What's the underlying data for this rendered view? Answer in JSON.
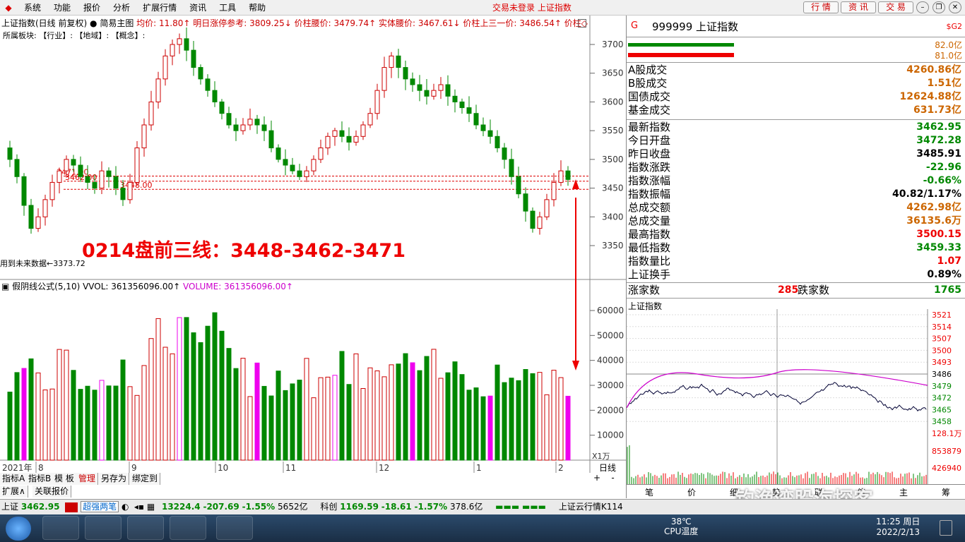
{
  "menu": {
    "items": [
      "系统",
      "功能",
      "报价",
      "分析",
      "扩展行情",
      "资讯",
      "工具",
      "帮助"
    ],
    "notice": "交易未登录  上证指数",
    "buttons": [
      "行 情",
      "资 讯",
      "交 易"
    ]
  },
  "info": {
    "line1": "上证指数(日线 前复权)",
    "main_chart": "简易主图",
    "junjia": "均价: 11.80↑",
    "zhangting": "明日涨停参考: 3809.25↓",
    "yaojia": "价柱腰价: 3479.74↑",
    "shiti": "实体腰价: 3467.61↓",
    "shangsan": "价柱上三一价: 3486.54↑",
    "jiazhu": "价柱◇",
    "line2": "所属板块:    【行业】:        【地域】:     【概念】:"
  },
  "kline": {
    "y_labels": [
      "3700",
      "3650",
      "3600",
      "3550",
      "3500",
      "3450",
      "3400",
      "3350"
    ],
    "hlines": [
      {
        "label": "3471.00",
        "value": 3471
      },
      {
        "label": "3462.00",
        "value": 3462
      },
      {
        "label": "3448.00",
        "value": 3448
      }
    ],
    "low_label": "用到未来数据",
    "low_value": "3373.72",
    "annotation": "0214盘前三线：3448-3462-3471"
  },
  "volume": {
    "title": "假阴线公式(5,10)",
    "vvol": "VVOL: 361356096.00↑",
    "volume": "VOLUME: 361356096.00↑",
    "y_labels": [
      "60000",
      "50000",
      "40000",
      "30000",
      "20000",
      "10000"
    ],
    "unit": "X1万"
  },
  "xaxis": {
    "year": "2021年",
    "months": [
      "8",
      "9",
      "10",
      "11",
      "12",
      "1",
      "2"
    ],
    "period": "日线"
  },
  "right": {
    "code": "999999",
    "name": "上证指数",
    "g": "G",
    "sg": "$G2",
    "bar_vals": [
      "82.0亿",
      "81.0亿"
    ],
    "rows1": [
      {
        "label": "A股成交",
        "value": "4260.86亿",
        "cls": "orange"
      },
      {
        "label": "B股成交",
        "value": "1.51亿",
        "cls": "orange"
      },
      {
        "label": "国债成交",
        "value": "12624.88亿",
        "cls": "orange"
      },
      {
        "label": "基金成交",
        "value": "631.73亿",
        "cls": "orange"
      }
    ],
    "rows2": [
      {
        "label": "最新指数",
        "value": "3462.95",
        "cls": "green"
      },
      {
        "label": "今日开盘",
        "value": "3472.28",
        "cls": "green"
      },
      {
        "label": "昨日收盘",
        "value": "3485.91",
        "cls": ""
      },
      {
        "label": "指数涨跌",
        "value": "-22.96",
        "cls": "green"
      },
      {
        "label": "指数涨幅",
        "value": "-0.66%",
        "cls": "green"
      },
      {
        "label": "指数振幅",
        "value": "40.82/1.17%",
        "cls": ""
      },
      {
        "label": "总成交额",
        "value": "4262.98亿",
        "cls": "orange"
      },
      {
        "label": "总成交量",
        "value": "36135.6万",
        "cls": "orange"
      },
      {
        "label": "最高指数",
        "value": "3500.15",
        "cls": "red"
      },
      {
        "label": "最低指数",
        "value": "3459.33",
        "cls": "green"
      },
      {
        "label": "指数量比",
        "value": "1.07",
        "cls": "red"
      },
      {
        "label": "上证换手",
        "value": "0.89%",
        "cls": ""
      }
    ],
    "rise_label": "涨家数",
    "rise": "285",
    "fall_label": "跌家数",
    "fall": "1765",
    "intraday_title": "上证指数",
    "intraday_y": [
      "3521",
      "3514",
      "3507",
      "3500",
      "3493",
      "3486",
      "3479",
      "3472",
      "3465",
      "3458"
    ],
    "intraday_vol": [
      "128.1万",
      "853879",
      "426940"
    ],
    "bottom_tabs": [
      "笔",
      "价",
      "细",
      "势",
      "联",
      "值",
      "主",
      "筹"
    ]
  },
  "tabs": {
    "row1": [
      "指标A",
      "指标B",
      "模 板",
      "管理",
      "另存为",
      "绑定到"
    ],
    "row2": [
      "扩展∧",
      "关联报价"
    ]
  },
  "status": {
    "sh_label": "上证",
    "sh_value": "3462.95",
    "chaoqiang": "超强两笔",
    "sz_value": "13224.4",
    "sz_change": "-207.69",
    "sz_pct": "-1.55%",
    "sz_amt": "5652亿",
    "kc_label": "科创",
    "kc_value": "1169.59",
    "kc_change": "-18.61",
    "kc_pct": "-1.57%",
    "kc_amt": "378.6亿",
    "cloud": "上证云行情K114"
  },
  "taskbar": {
    "temp": "38℃",
    "cpu": "CPU温度",
    "time": "11:25 周日",
    "date": "2022/2/13"
  },
  "watermark": "钓渔湾股海探客"
}
